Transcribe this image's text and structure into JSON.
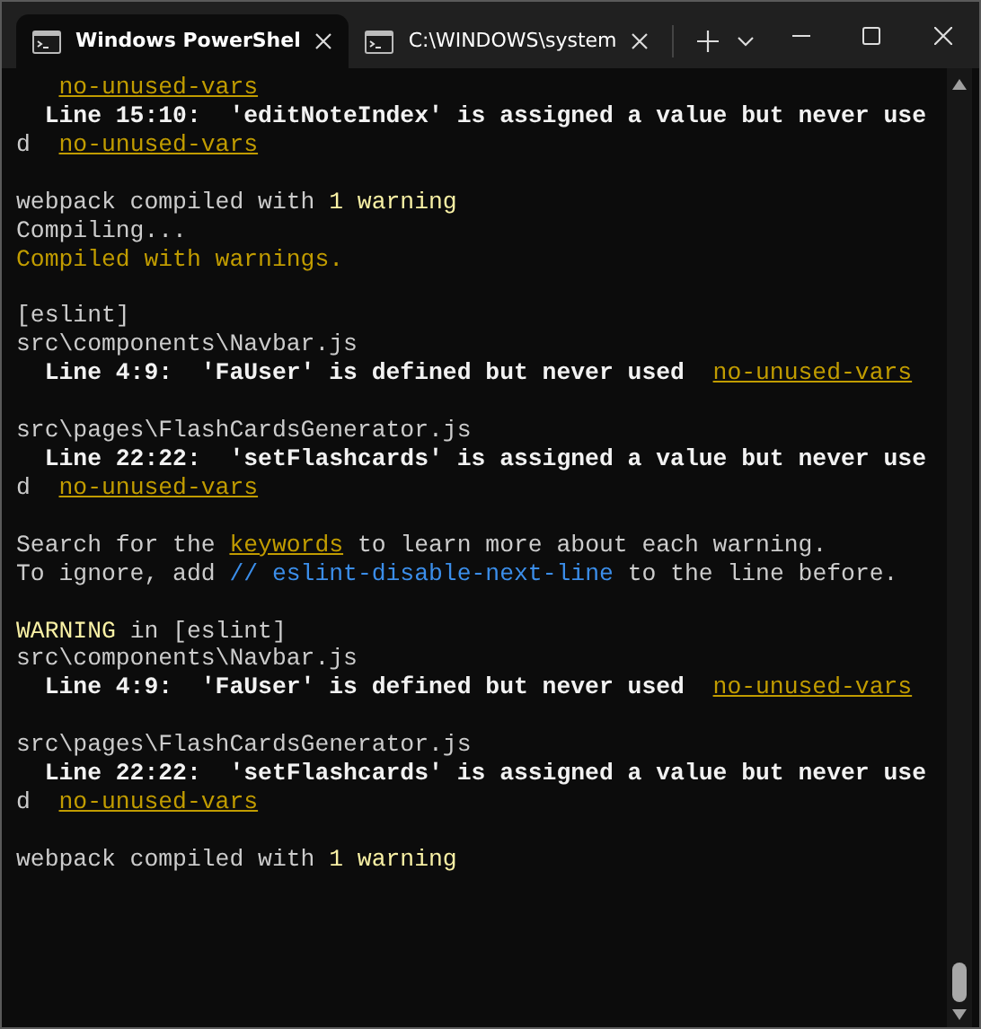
{
  "tabs": [
    {
      "title": "Windows PowerShel",
      "selected": true
    },
    {
      "title": "C:\\WINDOWS\\system",
      "selected": false
    }
  ],
  "terminal": {
    "lines": [
      {
        "kind": "indented",
        "segments": [
          {
            "kind": "link",
            "text": "no-unused-vars"
          }
        ]
      },
      {
        "kind": "text",
        "segments": [
          {
            "kind": "bold",
            "text": "  Line 15:10:  'editNoteIndex' is assigned a value but never use"
          }
        ]
      },
      {
        "kind": "text",
        "segments": [
          {
            "kind": "plain",
            "text": "d  "
          },
          {
            "kind": "link",
            "text": "no-unused-vars"
          }
        ]
      },
      {
        "kind": "blank"
      },
      {
        "kind": "text",
        "segments": [
          {
            "kind": "plain",
            "text": "webpack compiled with "
          },
          {
            "kind": "bright",
            "text": "1 warning"
          }
        ]
      },
      {
        "kind": "text",
        "segments": [
          {
            "kind": "plain",
            "text": "Compiling..."
          }
        ]
      },
      {
        "kind": "text",
        "segments": [
          {
            "kind": "yellow",
            "text": "Compiled with warnings."
          }
        ]
      },
      {
        "kind": "blank"
      },
      {
        "kind": "text",
        "segments": [
          {
            "kind": "plain",
            "text": "[eslint]"
          }
        ]
      },
      {
        "kind": "text",
        "segments": [
          {
            "kind": "plain",
            "text": "src\\components\\Navbar.js"
          }
        ]
      },
      {
        "kind": "text",
        "segments": [
          {
            "kind": "bold",
            "text": "  Line 4:9:  'FaUser' is defined but never used  "
          },
          {
            "kind": "link",
            "text": "no-unused-vars"
          }
        ]
      },
      {
        "kind": "blank"
      },
      {
        "kind": "text",
        "segments": [
          {
            "kind": "plain",
            "text": "src\\pages\\FlashCardsGenerator.js"
          }
        ]
      },
      {
        "kind": "text",
        "segments": [
          {
            "kind": "bold",
            "text": "  Line 22:22:  'setFlashcards' is assigned a value but never use"
          }
        ]
      },
      {
        "kind": "text",
        "segments": [
          {
            "kind": "plain",
            "text": "d  "
          },
          {
            "kind": "link",
            "text": "no-unused-vars"
          }
        ]
      },
      {
        "kind": "blank"
      },
      {
        "kind": "text",
        "segments": [
          {
            "kind": "plain",
            "text": "Search for the "
          },
          {
            "kind": "link",
            "text": "keywords"
          },
          {
            "kind": "plain",
            "text": " to learn more about each warning."
          }
        ]
      },
      {
        "kind": "text",
        "segments": [
          {
            "kind": "plain",
            "text": "To ignore, add "
          },
          {
            "kind": "blue",
            "text": "// eslint-disable-next-line"
          },
          {
            "kind": "plain",
            "text": " to the line before."
          }
        ]
      },
      {
        "kind": "blank"
      },
      {
        "kind": "text",
        "segments": [
          {
            "kind": "bright",
            "text": "WARNING"
          },
          {
            "kind": "plain",
            "text": " in [eslint]"
          }
        ]
      },
      {
        "kind": "text",
        "segments": [
          {
            "kind": "plain",
            "text": "src\\components\\Navbar.js"
          }
        ]
      },
      {
        "kind": "text",
        "segments": [
          {
            "kind": "bold",
            "text": "  Line 4:9:  'FaUser' is defined but never used  "
          },
          {
            "kind": "link",
            "text": "no-unused-vars"
          }
        ]
      },
      {
        "kind": "blank"
      },
      {
        "kind": "text",
        "segments": [
          {
            "kind": "plain",
            "text": "src\\pages\\FlashCardsGenerator.js"
          }
        ]
      },
      {
        "kind": "text",
        "segments": [
          {
            "kind": "bold",
            "text": "  Line 22:22:  'setFlashcards' is assigned a value but never use"
          }
        ]
      },
      {
        "kind": "text",
        "segments": [
          {
            "kind": "plain",
            "text": "d  "
          },
          {
            "kind": "link",
            "text": "no-unused-vars"
          }
        ]
      },
      {
        "kind": "blank"
      },
      {
        "kind": "text",
        "segments": [
          {
            "kind": "plain",
            "text": "webpack compiled with "
          },
          {
            "kind": "bright",
            "text": "1 warning"
          }
        ]
      }
    ]
  }
}
